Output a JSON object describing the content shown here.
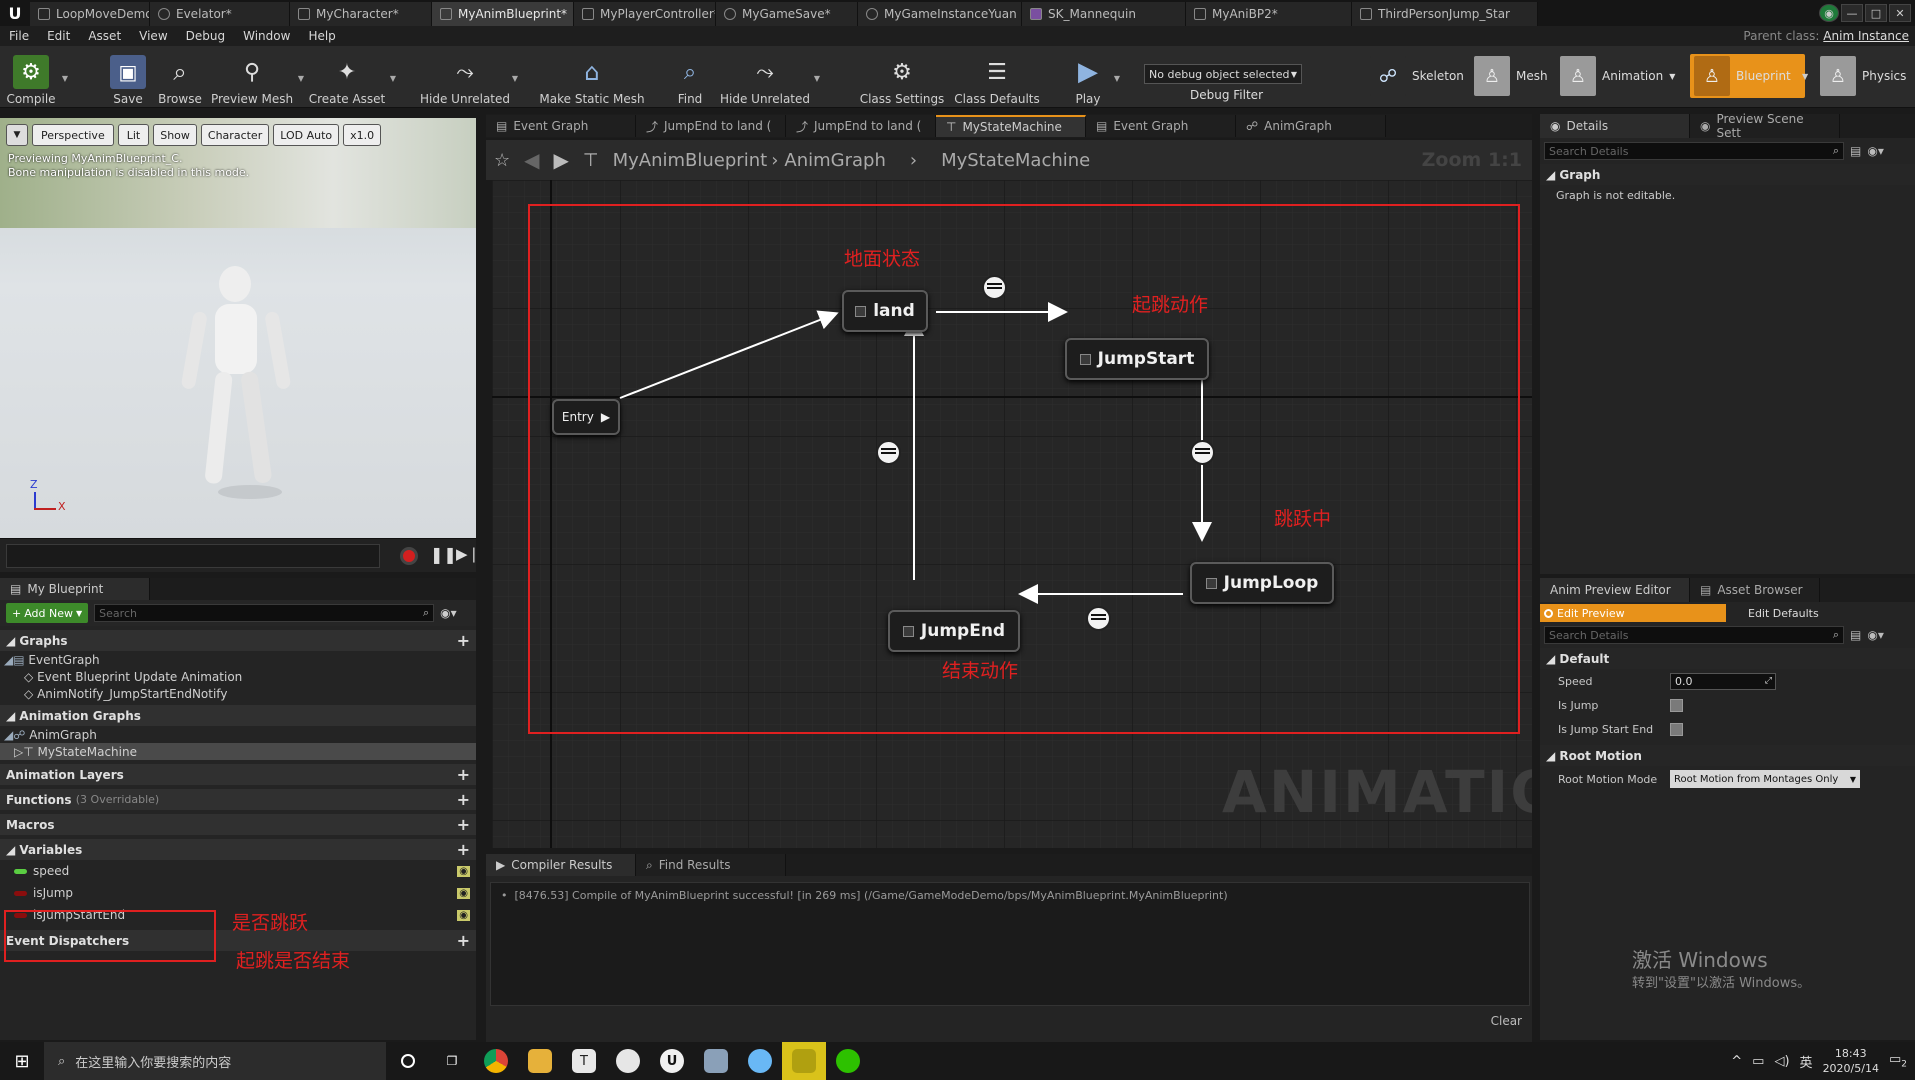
{
  "titlebar": {
    "tabs": [
      {
        "label": "LoopMoveDemoMap",
        "active": false
      },
      {
        "label": "Evelator*",
        "active": false
      },
      {
        "label": "MyCharacter*",
        "active": false
      },
      {
        "label": "MyAnimBlueprint*",
        "active": true
      },
      {
        "label": "MyPlayerController*",
        "active": false
      },
      {
        "label": "MyGameSave*",
        "active": false
      },
      {
        "label": "MyGameInstanceYuan",
        "active": false
      },
      {
        "label": "SK_Mannequin",
        "active": false
      },
      {
        "label": "MyAniBP2*",
        "active": false
      },
      {
        "label": "ThirdPersonJump_Star",
        "active": false
      }
    ]
  },
  "menu": {
    "items": [
      "File",
      "Edit",
      "Asset",
      "View",
      "Debug",
      "Window",
      "Help"
    ],
    "parent_class_label": "Parent class:",
    "parent_class_value": "Anim Instance"
  },
  "toolbar": {
    "compile": "Compile",
    "save": "Save",
    "browse": "Browse",
    "preview_mesh": "Preview Mesh",
    "create_asset": "Create Asset",
    "hide_unrelated_1": "Hide Unrelated",
    "make_static_mesh": "Make Static Mesh",
    "find": "Find",
    "hide_unrelated_2": "Hide Unrelated",
    "class_settings": "Class Settings",
    "class_defaults": "Class Defaults",
    "play": "Play",
    "debug_select": "No debug object selected",
    "debug_filter": "Debug Filter",
    "modes": [
      "Skeleton",
      "Mesh",
      "Animation",
      "Blueprint",
      "Physics"
    ]
  },
  "viewport": {
    "perspective": "Perspective",
    "lit": "Lit",
    "show": "Show",
    "character": "Character",
    "lod": "LOD Auto",
    "speed": "x1.0",
    "info_line1": "Previewing MyAnimBlueprint_C.",
    "info_line2": "Bone manipulation is disabled in this mode.",
    "axis_z": "Z",
    "axis_x": "X"
  },
  "my_blueprint": {
    "tab": "My Blueprint",
    "add_new": "Add New",
    "search_placeholder": "Search",
    "graphs": "Graphs",
    "event_graph": "EventGraph",
    "event_update": "Event Blueprint Update Animation",
    "anim_notify": "AnimNotify_JumpStartEndNotify",
    "animation_graphs": "Animation Graphs",
    "anim_graph": "AnimGraph",
    "state_machine": "MyStateMachine",
    "animation_layers": "Animation Layers",
    "functions": "Functions",
    "functions_count": "(3 Overridable)",
    "macros": "Macros",
    "variables": "Variables",
    "vars": [
      {
        "name": "speed",
        "color": "#5acd42"
      },
      {
        "name": "isJump",
        "color": "#8a0d0d"
      },
      {
        "name": "isJumpStartEnd",
        "color": "#8a0d0d"
      }
    ],
    "annot_isjump": "是否跳跃",
    "annot_isjumpstartend": "起跳是否结束",
    "event_dispatchers": "Event Dispatchers"
  },
  "graph_tabs": [
    "Event Graph",
    "JumpEnd to land (",
    "JumpEnd to land (",
    "MyStateMachine",
    "Event Graph",
    "AnimGraph"
  ],
  "breadcrumb": {
    "root": "MyAnimBlueprint",
    "anim_graph": "AnimGraph",
    "state_machine": "MyStateMachine",
    "zoom": "Zoom 1:1"
  },
  "graph": {
    "entry": "Entry",
    "nodes": {
      "land": "land",
      "jumpstart": "JumpStart",
      "jumploop": "JumpLoop",
      "jumpend": "JumpEnd"
    },
    "annotations": {
      "land": "地面状态",
      "jumpstart": "起跳动作",
      "jumploop": "跳跃中",
      "jumpend": "结束动作"
    },
    "watermark": "ANIMATION"
  },
  "compiler": {
    "tab_results": "Compiler Results",
    "tab_find": "Find Results",
    "message": "[8476.53] Compile of MyAnimBlueprint successful! [in 269 ms] (/Game/GameModeDemo/bps/MyAnimBlueprint.MyAnimBlueprint)",
    "clear": "Clear"
  },
  "details": {
    "tab": "Details",
    "tab2": "Preview Scene Sett",
    "search_placeholder": "Search Details",
    "section": "Graph",
    "message": "Graph is not editable."
  },
  "anim_preview": {
    "tab": "Anim Preview Editor",
    "tab2": "Asset Browser",
    "edit_preview": "Edit Preview",
    "edit_defaults": "Edit Defaults",
    "search_placeholder": "Search Details",
    "default_section": "Default",
    "speed_label": "Speed",
    "speed_value": "0.0",
    "is_jump_label": "Is Jump",
    "is_jump_start_end_label": "Is Jump Start End",
    "root_motion_section": "Root Motion",
    "root_motion_mode_label": "Root Motion Mode",
    "root_motion_mode_value": "Root Motion from Montages Only"
  },
  "windows_watermark": {
    "line1": "激活 Windows",
    "line2": "转到\"设置\"以激活 Windows。"
  },
  "taskbar": {
    "search_placeholder": "在这里输入你要搜索的内容",
    "ime": "英",
    "time": "18:43",
    "date": "2020/5/14",
    "notification_count": "2"
  }
}
